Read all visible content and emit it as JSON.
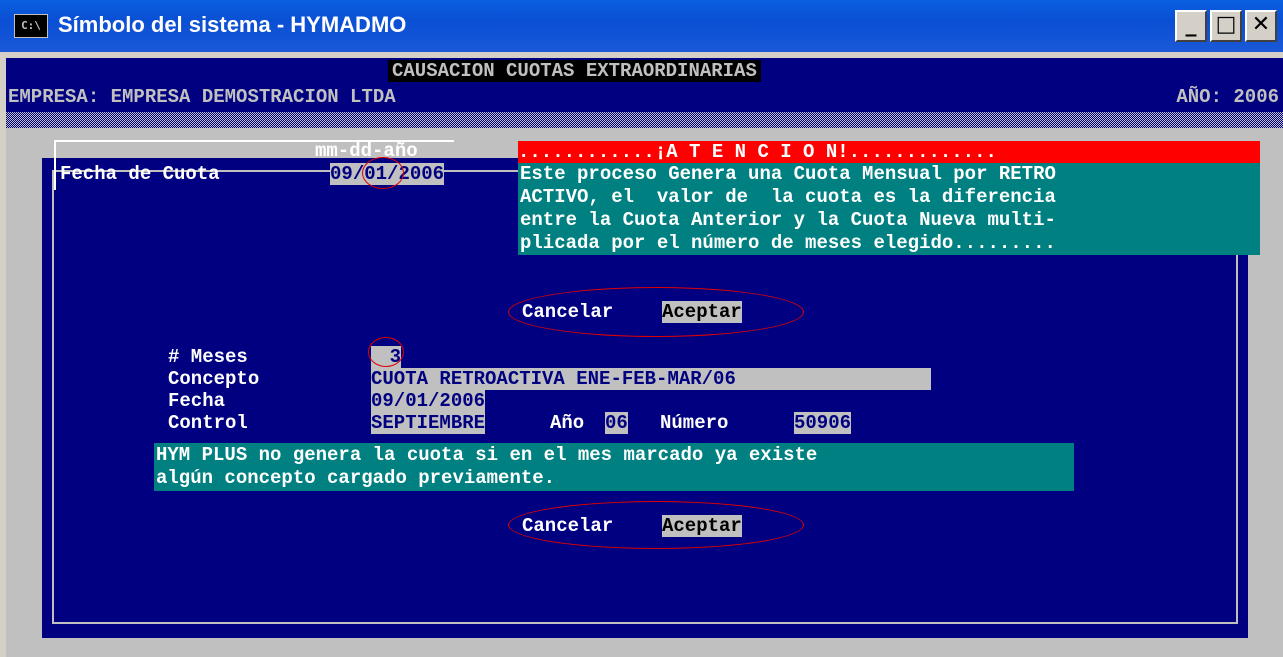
{
  "window": {
    "title": "Símbolo del sistema - HYMADMO",
    "icon_label": "C:\\",
    "min_label": "_",
    "max_label": "□",
    "close_label": "✕"
  },
  "header": {
    "title": "CAUSACION CUOTAS EXTRAORDINARIAS",
    "empresa": "EMPRESA: EMPRESA DEMOSTRACION LTDA",
    "ano": "AÑO: 2006"
  },
  "fecha": {
    "format_hint": "mm-dd-año",
    "label": "Fecha de Cuota",
    "mm": "09",
    "dd": "01",
    "yyyy": "2006"
  },
  "atencion": {
    "heading": "............¡A T E N C I O N!.............",
    "lines": [
      "Este proceso Genera una Cuota Mensual por RETRO",
      "ACTIVO, el  valor de  la cuota es la diferencia",
      "entre la Cuota Anterior y la Cuota Nueva multi-",
      "plicada por el número de meses elegido........."
    ]
  },
  "buttons_top": {
    "cancel": "Cancelar",
    "ok": "Aceptar"
  },
  "form": {
    "meses_label": "# Meses",
    "meses_value": "3",
    "concepto_label": "Concepto",
    "concepto_value": "CUOTA RETROACTIVA ENE-FEB-MAR/06",
    "fecha_label": "Fecha",
    "fecha_value": "09/01/2006",
    "control_label": "Control",
    "control_mes": "SEPTIEMBRE",
    "ano_label": "Año",
    "ano_value": "06",
    "numero_label": "Número",
    "numero_value": "50906"
  },
  "note": {
    "lines": [
      "HYM PLUS no genera la cuota si en el mes marcado ya existe",
      "algún concepto cargado previamente."
    ]
  },
  "buttons_bottom": {
    "cancel": "Cancelar",
    "ok": "Aceptar"
  },
  "colors": {
    "console_bg": "#000080",
    "highlight": "#c0c0c0",
    "attention_head": "#ff0000",
    "attention_body": "#008080",
    "annotation": "#e00000"
  }
}
